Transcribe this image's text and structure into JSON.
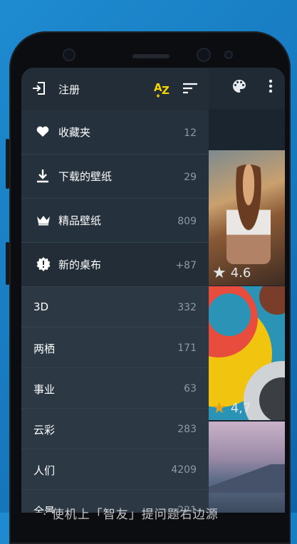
{
  "colors": {
    "background": "#1677bd",
    "drawer": "#2c3945",
    "drawer_header": "#222d38",
    "accent_yellow": "#f5d400",
    "rating_star": "#e3a21a"
  },
  "toolbar": {
    "palette_icon": "palette-icon",
    "more_icon": "more-vert-icon"
  },
  "drawer": {
    "header": {
      "login_icon": "login-icon",
      "login_label": "注册",
      "sort_az_icon": "sort-az-icon",
      "sort_icon": "sort-icon"
    },
    "top_items": [
      {
        "icon": "heart-icon",
        "label": "收藏夹",
        "count": "12"
      },
      {
        "icon": "download-icon",
        "label": "下载的壁纸",
        "count": "29"
      },
      {
        "icon": "crown-icon",
        "label": "精品壁纸",
        "count": "809"
      },
      {
        "icon": "new-badge-icon",
        "label": "新的桌布",
        "count": "+87"
      }
    ],
    "categories": [
      {
        "label": "3D",
        "count": "332"
      },
      {
        "label": "两栖",
        "count": "171"
      },
      {
        "label": "事业",
        "count": "63"
      },
      {
        "label": "云彩",
        "count": "283"
      },
      {
        "label": "人们",
        "count": "4209"
      },
      {
        "label": "全景",
        "count": "221"
      }
    ]
  },
  "wallpapers": [
    {
      "rating": "4.6"
    },
    {
      "rating": "4,7"
    }
  ],
  "overlay_text": "· 使机上「智友」提问题右边源"
}
